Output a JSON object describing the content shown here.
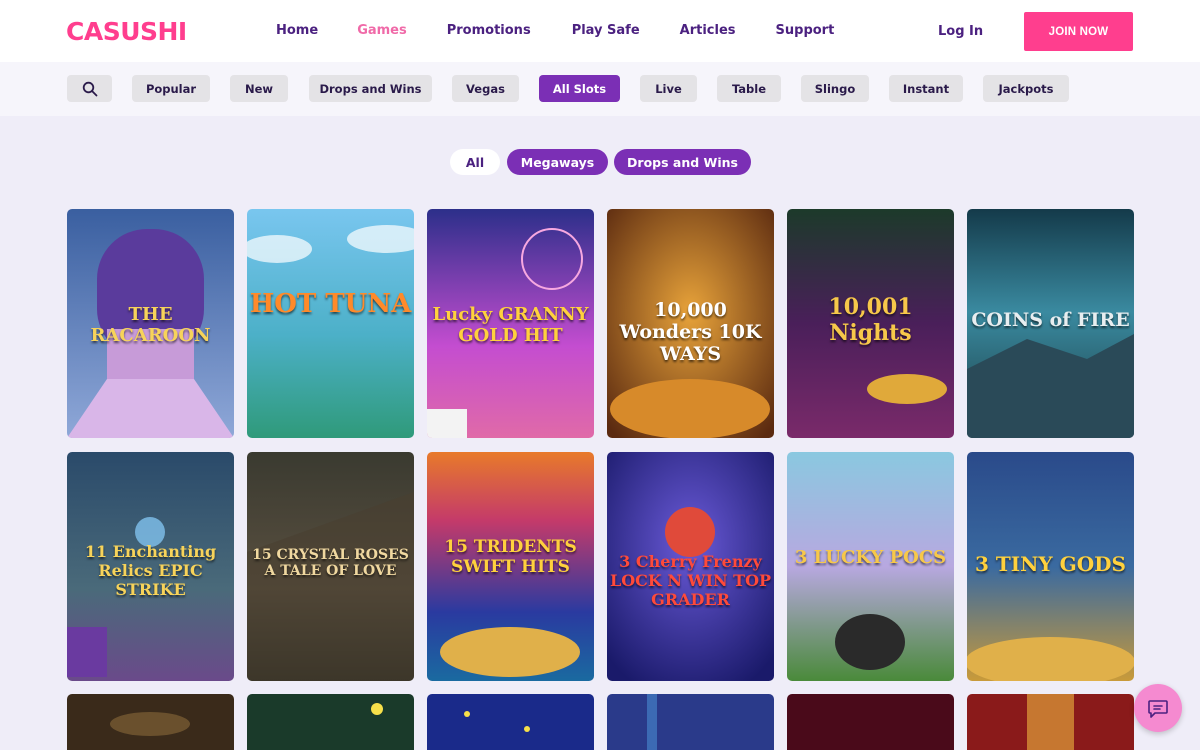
{
  "header": {
    "logo": "CASUSHI",
    "nav": [
      "Home",
      "Games",
      "Promotions",
      "Play Safe",
      "Articles",
      "Support"
    ],
    "active_nav": "Games",
    "login": "Log In",
    "join": "JOIN NOW"
  },
  "categories": {
    "search_icon": "search-icon",
    "items": [
      "Popular",
      "New",
      "Drops and Wins",
      "Vegas",
      "All Slots",
      "Live",
      "Table",
      "Slingo",
      "Instant",
      "Jackpots"
    ],
    "active": "All Slots"
  },
  "subfilters": {
    "items": [
      "All",
      "Megaways",
      "Drops and Wins"
    ],
    "active": "All"
  },
  "games": {
    "row1": [
      "THE RACAROON",
      "HOT TUNA",
      "Lucky GRANNY GOLD HIT",
      "10,000 Wonders 10K WAYS",
      "10,001 Nights",
      "COINS of FIRE"
    ],
    "row2": [
      "11 Enchanting Relics EPIC STRIKE",
      "15 CRYSTAL ROSES A TALE OF LOVE",
      "15 TRIDENTS SWIFT HITS",
      "3 Cherry Frenzy LOCK N WIN TOP GRADER",
      "3 LUCKY POCS",
      "3 TINY GODS"
    ]
  },
  "chat": {
    "icon": "chat-icon"
  },
  "colors": {
    "brand_pink": "#ff3e8e",
    "accent_purple": "#7b2fb5",
    "nav_text": "#4b2180",
    "page_bg": "#efedf8"
  }
}
